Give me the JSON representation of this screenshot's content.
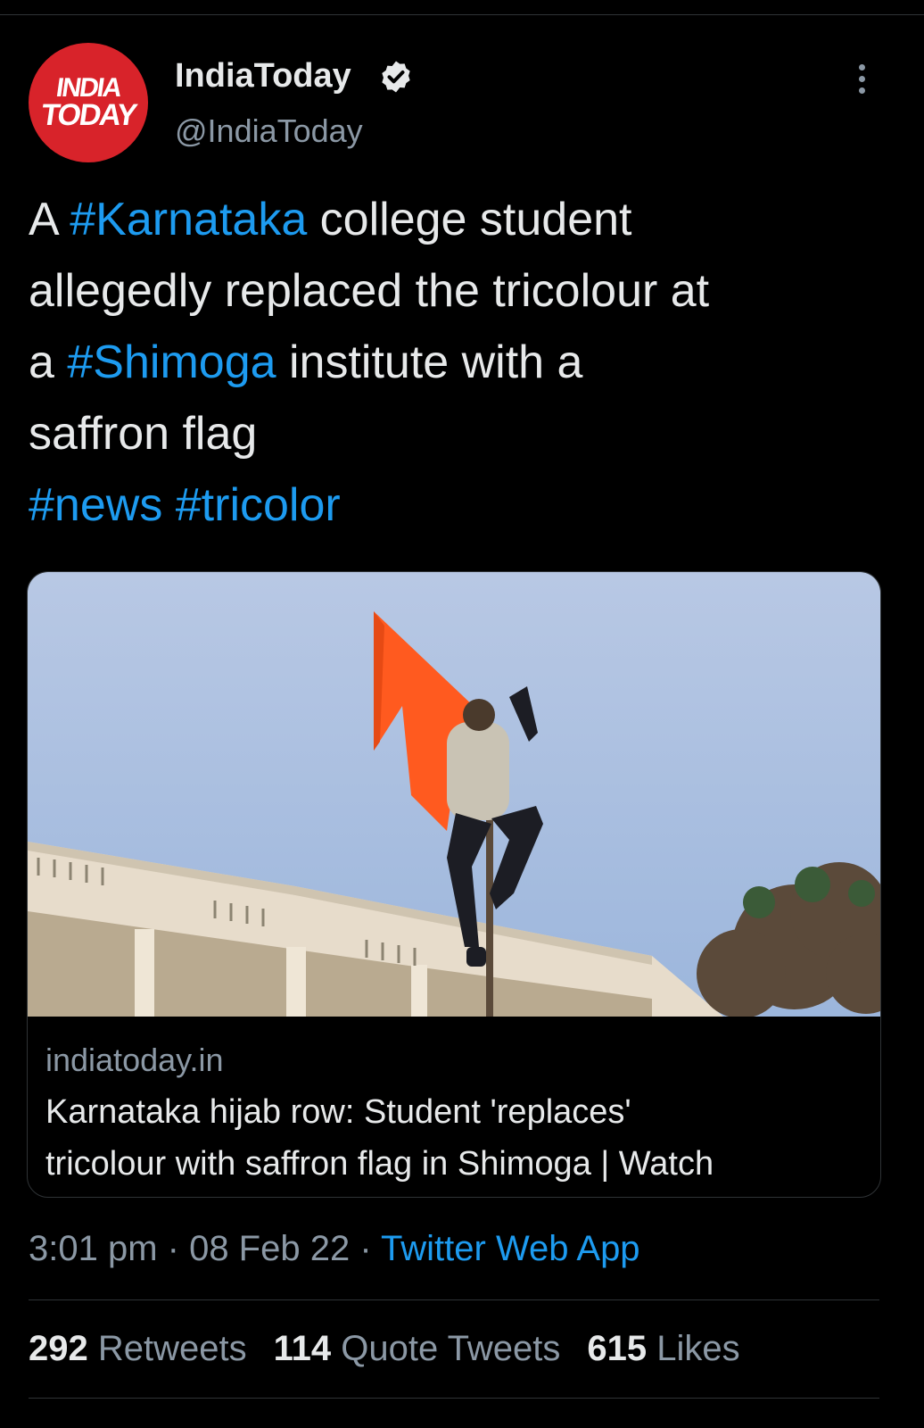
{
  "author": {
    "avatar_logo_line1": "INDIA",
    "avatar_logo_line2": "TODAY",
    "name": "IndiaToday",
    "handle": "@IndiaToday"
  },
  "tweet": {
    "lines": [
      {
        "parts": [
          {
            "text": "A ",
            "tag": false
          },
          {
            "text": "#Karnataka",
            "tag": true
          },
          {
            "text": " college student",
            "tag": false
          }
        ]
      },
      {
        "parts": [
          {
            "text": "allegedly replaced the tricolour at",
            "tag": false
          }
        ]
      },
      {
        "parts": [
          {
            "text": "a ",
            "tag": false
          },
          {
            "text": "#Shimoga",
            "tag": true
          },
          {
            "text": " institute with a",
            "tag": false
          }
        ]
      },
      {
        "parts": [
          {
            "text": "saffron flag",
            "tag": false
          }
        ]
      },
      {
        "parts": [
          {
            "text": "#news",
            "tag": true
          },
          {
            "text": " ",
            "tag": false
          },
          {
            "text": "#tricolor",
            "tag": true
          }
        ]
      }
    ]
  },
  "card": {
    "domain": "indiatoday.in",
    "title_line1": "Karnataka hijab row: Student 'replaces'",
    "title_line2": "tricolour with saffron flag in Shimoga | Watch"
  },
  "meta": {
    "time": "3:01 pm",
    "sep1": " · ",
    "date": "08 Feb 22",
    "sep2": " · ",
    "source": "Twitter Web App"
  },
  "stats": {
    "retweets_count": "292",
    "retweets_label": "Retweets",
    "quotes_count": "114",
    "quotes_label": "Quote Tweets",
    "likes_count": "615",
    "likes_label": "Likes"
  },
  "colors": {
    "background": "#000000",
    "text": "#e7e9ea",
    "secondary": "#8b98a5",
    "link": "#1d9bf0",
    "brand_red": "#d8232a",
    "flag_saffron": "#ff5a1f"
  }
}
